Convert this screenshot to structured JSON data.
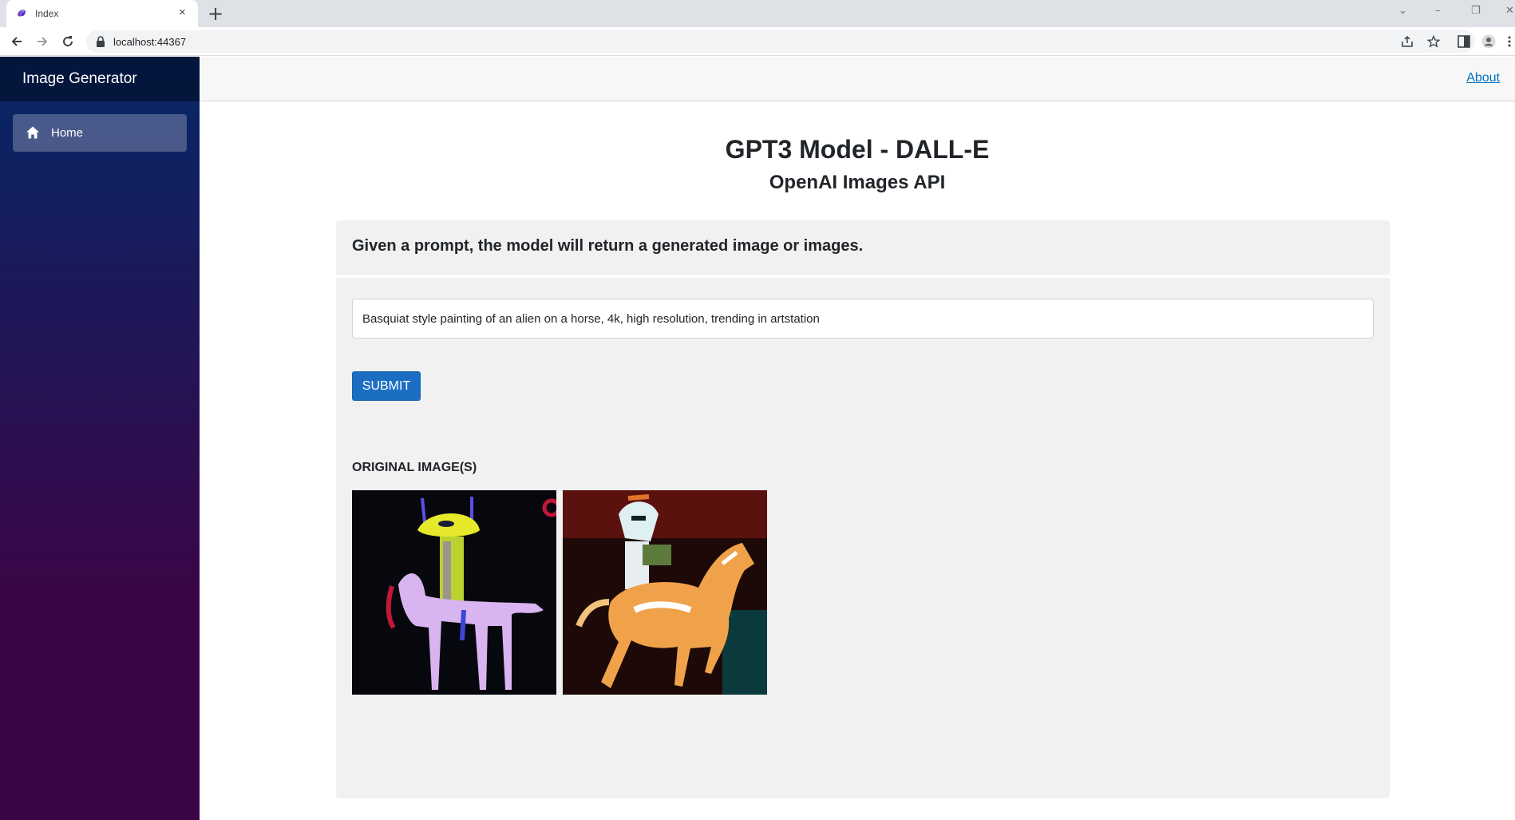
{
  "browser": {
    "tab_title": "Index",
    "tab_close": "×",
    "new_tab": "+",
    "url": "localhost:44367",
    "window_controls": {
      "dropdown": "⌄",
      "minimize": "–",
      "restore": "❐",
      "close": "✕"
    }
  },
  "sidebar": {
    "brand": "Image Generator",
    "items": [
      {
        "label": "Home",
        "icon": "home-icon"
      }
    ]
  },
  "top_row": {
    "about_link": "About"
  },
  "main": {
    "title": "GPT3 Model - DALL-E",
    "subtitle": "OpenAI Images API",
    "card_header": "Given a prompt, the model will return a generated image or images.",
    "prompt_value": "Basquiat style painting of an alien on a horse, 4k, high resolution, trending in artstation",
    "submit_label": "SUBMIT",
    "images_label": "ORIGINAL IMAGE(S)"
  },
  "colors": {
    "sidebar_top": "#052767",
    "sidebar_bottom": "#3a0647",
    "button": "#1b6ec2",
    "link": "#0071c1",
    "card": "#f1f1f1"
  }
}
